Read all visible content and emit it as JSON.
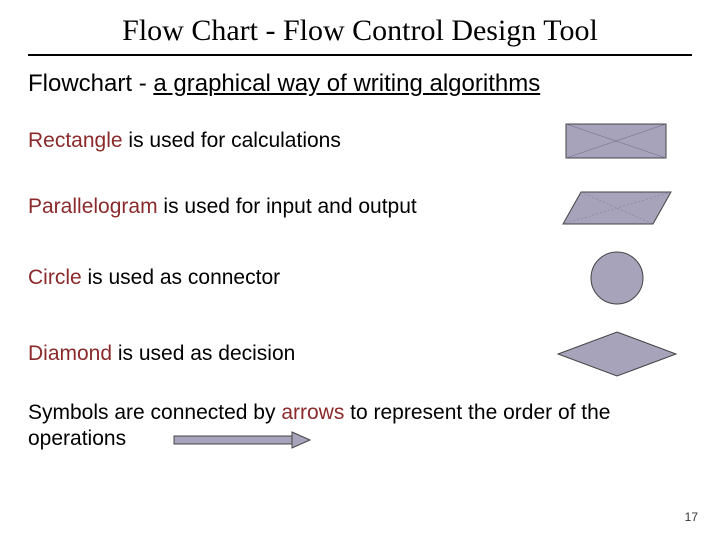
{
  "title": "Flow  Chart - Flow Control Design Tool",
  "subtitle_plain": "Flowchart - ",
  "subtitle_underlined": "a graphical way of writing algorithms",
  "items": [
    {
      "kw": "Rectangle",
      "rest": " is used for calculations",
      "shape": "rectangle"
    },
    {
      "kw": "Parallelogram",
      "rest": " is used for input and output",
      "shape": "parallelogram"
    },
    {
      "kw": "Circle",
      "rest": " is used as connector",
      "shape": "circle"
    },
    {
      "kw": "Diamond",
      "rest": " is used as decision",
      "shape": "diamond"
    }
  ],
  "footer_pre": "Symbols are connected by ",
  "footer_kw": "arrows",
  "footer_post": " to represent the order of the  operations",
  "page_number": "17",
  "shape_fill": "#a6a3ba",
  "shape_stroke": "#444"
}
